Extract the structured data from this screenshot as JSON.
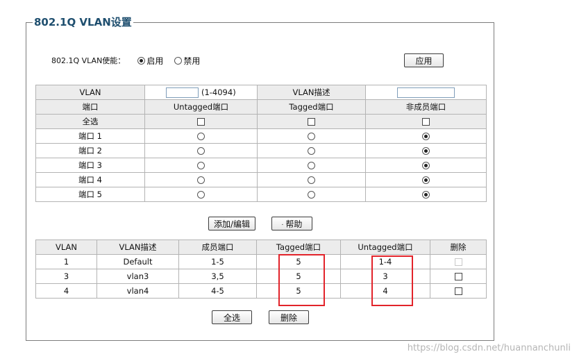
{
  "legend": "802.1Q VLAN设置",
  "enable": {
    "label": "802.1Q VLAN使能：",
    "options": [
      {
        "label": "启用",
        "checked": true
      },
      {
        "label": "禁用",
        "checked": false
      }
    ],
    "apply_label": "应用"
  },
  "config_table": {
    "vlan_label": "VLAN",
    "vlan_range": "(1-4094)",
    "desc_label": "VLAN描述",
    "vlan_value": "",
    "desc_value": "",
    "headers": [
      "端口",
      "Untagged端口",
      "Tagged端口",
      "非成员端口"
    ],
    "select_all": "全选",
    "ports": [
      {
        "label": "端口 1",
        "selected": "nonmember"
      },
      {
        "label": "端口 2",
        "selected": "nonmember"
      },
      {
        "label": "端口 3",
        "selected": "nonmember"
      },
      {
        "label": "端口 4",
        "selected": "nonmember"
      },
      {
        "label": "端口 5",
        "selected": "nonmember"
      }
    ]
  },
  "buttons": {
    "add_edit": "添加/编辑",
    "help": "帮助",
    "select_all": "全选",
    "delete": "删除"
  },
  "vlan_table": {
    "headers": [
      "VLAN",
      "VLAN描述",
      "成员端口",
      "Tagged端口",
      "Untagged端口",
      "删除"
    ],
    "rows": [
      {
        "vlan": "1",
        "desc": "Default",
        "members": "1-5",
        "tagged": "5",
        "untagged": "1-4",
        "delete_disabled": true
      },
      {
        "vlan": "3",
        "desc": "vlan3",
        "members": "3,5",
        "tagged": "5",
        "untagged": "3",
        "delete_disabled": false
      },
      {
        "vlan": "4",
        "desc": "vlan4",
        "members": "4-5",
        "tagged": "5",
        "untagged": "4",
        "delete_disabled": false
      }
    ]
  },
  "colors": {
    "legend": "#1f4f6f",
    "highlight_border": "#e2232a",
    "header_bg": "#ececec"
  },
  "watermark": "https://blog.csdn.net/huannanchunli"
}
